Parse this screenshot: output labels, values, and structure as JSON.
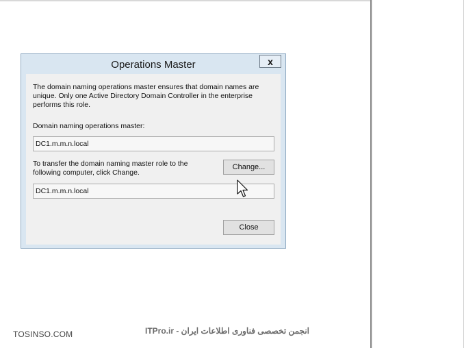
{
  "dialog": {
    "title": "Operations Master",
    "close_glyph": "x",
    "description": "The domain naming operations master ensures that domain names are unique. Only one Active Directory Domain Controller in the enterprise performs this role.",
    "current_master_label": "Domain naming operations master:",
    "current_master_value": "DC1.m.m.n.local",
    "transfer_text": "To transfer the domain naming master role to the following computer, click Change.",
    "change_button": "Change...",
    "target_value": "DC1.m.m.n.local",
    "close_button": "Close"
  },
  "watermark": {
    "left": "TOSINSO.COM",
    "center": "ITPro.ir - انجمن تخصصی فناوری اطلاعات ایران"
  },
  "icons": {
    "cursor": "mouse-pointer-icon"
  }
}
